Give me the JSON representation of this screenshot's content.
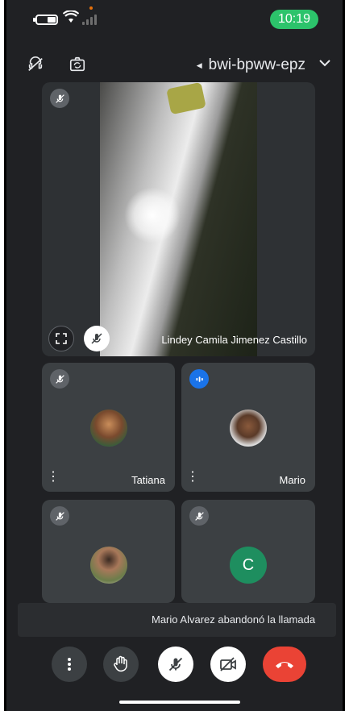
{
  "status_bar": {
    "time": "10:19",
    "icons": [
      "battery-icon",
      "wifi-icon",
      "signal-icon"
    ],
    "colors": {
      "time_pill": "#2cc36b",
      "dot": "#e8710a"
    }
  },
  "header": {
    "meeting_code": "bwi-bpww-epz",
    "icons": [
      "audio-off-icon",
      "switch-camera-icon",
      "chevron-down-icon"
    ]
  },
  "main_tile": {
    "participant_name": "Lindey Camila Jimenez Castillo",
    "icons": [
      "mic-off-icon",
      "mic-off-icon",
      "fullscreen-icon"
    ]
  },
  "participants": [
    {
      "name": "Tatiana",
      "status": "muted"
    },
    {
      "name": "Mario",
      "status": "speaking"
    },
    {
      "name": "",
      "status": "muted"
    },
    {
      "name": "",
      "status": "muted",
      "initial": "C",
      "avatar_color": "#1e8e5f"
    }
  ],
  "toast": {
    "message": "Mario Alvarez abandonó la llamada"
  },
  "controls": {
    "buttons": [
      "more-options-icon",
      "raise-hand-icon",
      "mic-off-icon",
      "camera-off-icon",
      "end-call-icon"
    ],
    "colors": {
      "end_call": "#ea4335",
      "light_button": "#ffffff",
      "dark_button": "#3c4043"
    }
  }
}
